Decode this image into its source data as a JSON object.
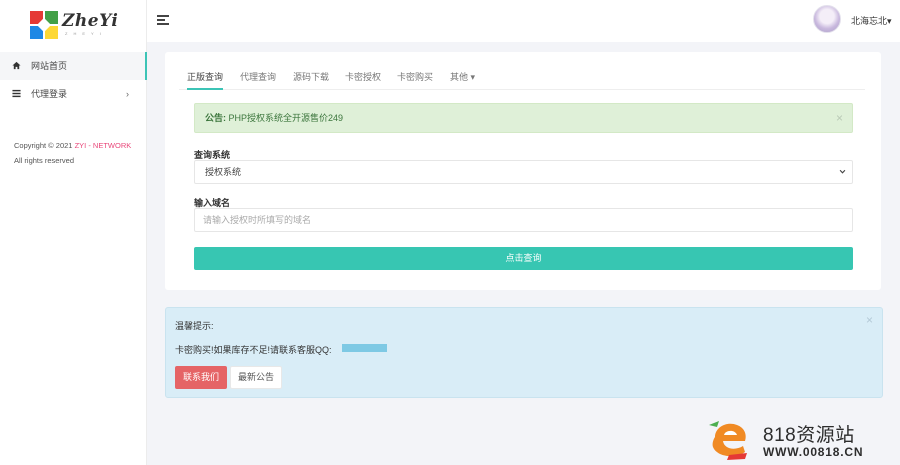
{
  "brand": {
    "logo_text": "ZheYi",
    "logo_subtext": "ZHEYI"
  },
  "sidebar": {
    "items": [
      {
        "label": "网站首页",
        "icon": "home-icon"
      },
      {
        "label": "代理登录",
        "icon": "list-icon"
      }
    ],
    "copyright_prefix": "Copyright © 2021",
    "copyright_link": "ZYI - NETWORK",
    "copyright_suffix": "All rights reserved"
  },
  "header": {
    "username": "北海忘北",
    "caret": "▾"
  },
  "tabs": [
    "正版查询",
    "代理查询",
    "源码下载",
    "卡密授权",
    "卡密购买",
    "其他"
  ],
  "tab_more_caret": "▾",
  "announcement": {
    "label": "公告:",
    "text": "PHP授权系统全开源售价249"
  },
  "form": {
    "system_label": "查询系统",
    "system_value": "授权系统",
    "domain_label": "输入域名",
    "domain_placeholder": "请输入授权时所填写的域名",
    "submit_label": "点击查询"
  },
  "info": {
    "title": "温馨提示:",
    "text": "卡密购买!如果库存不足!请联系客服QQ:",
    "contact_button": "联系我们",
    "notice_button": "最新公告"
  },
  "watermark": {
    "name": "818资源站",
    "url": "WWW.00818.CN"
  },
  "colors": {
    "accent": "#37c6b2",
    "alert_green": "#dff0d8",
    "info_blue": "#d9edf7",
    "danger": "#e56466",
    "link_pink": "#e9477a"
  }
}
